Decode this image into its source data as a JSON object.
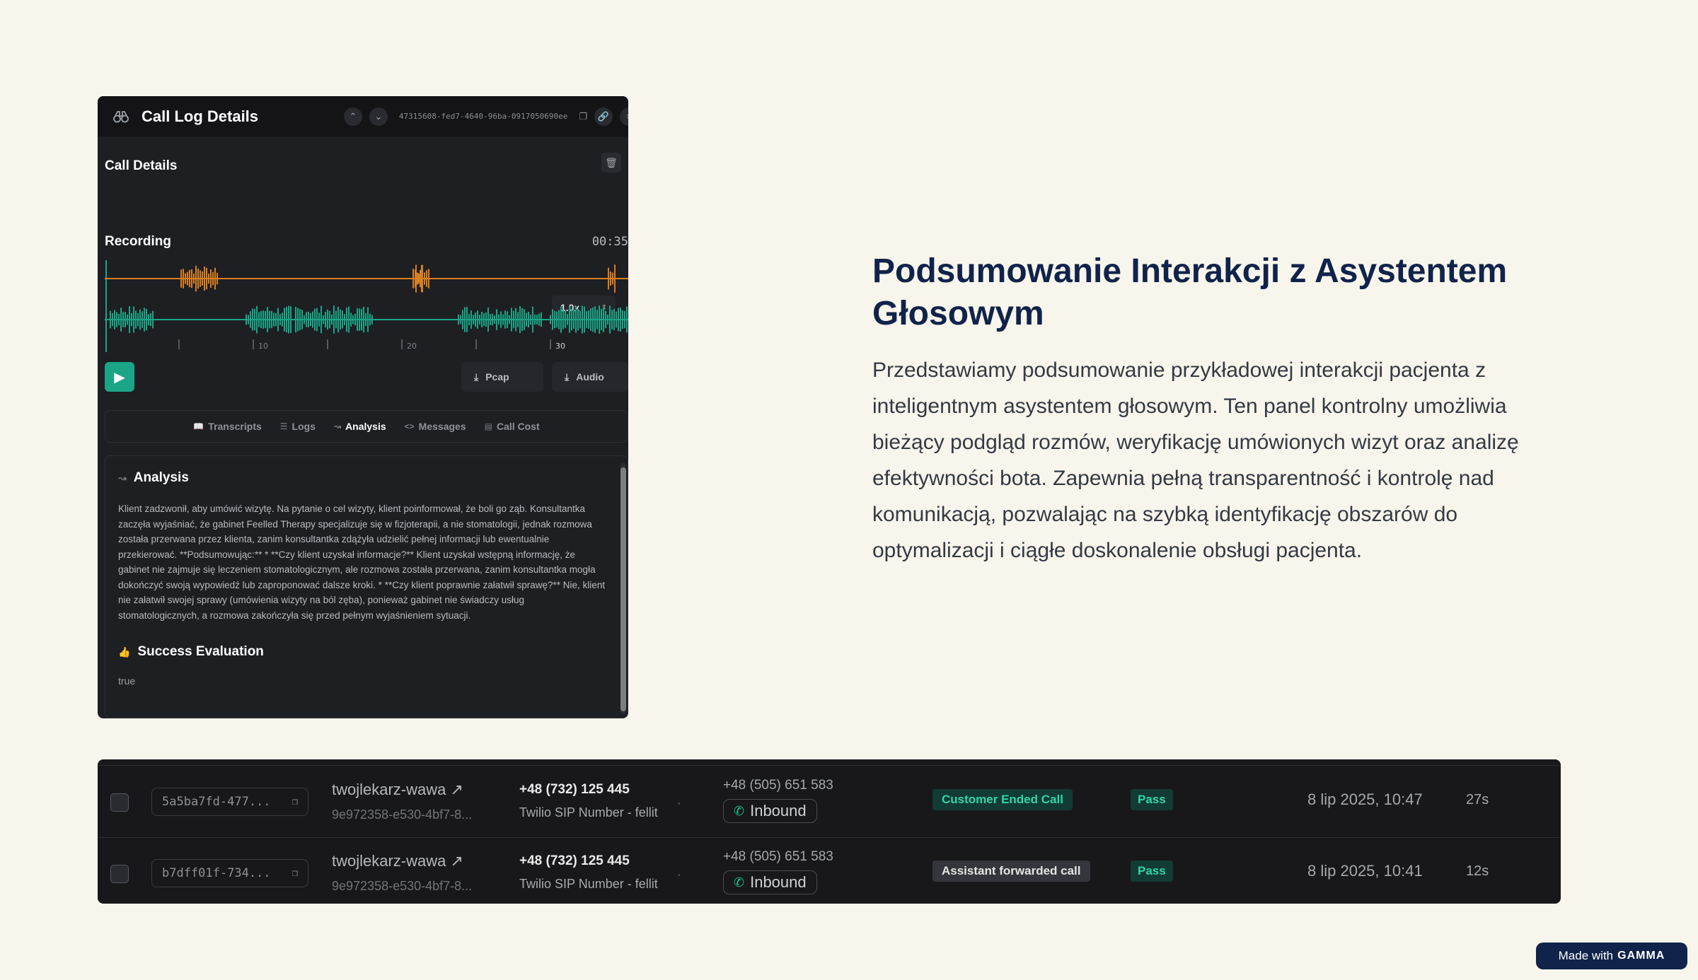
{
  "panel": {
    "header_title": "Call Log Details",
    "call_id": "47315608-fed7-4640-96ba-0917050690ee",
    "call_details_title": "Call Details",
    "speed": "1.0x",
    "recording_title": "Recording",
    "recording_time": "00:35",
    "timeline_ticks": [
      "10",
      "20",
      "30"
    ],
    "pcap_label": "Pcap",
    "audio_label": "Audio",
    "tabs": [
      {
        "label": "Transcripts",
        "icon": "book-icon"
      },
      {
        "label": "Logs",
        "icon": "list-icon"
      },
      {
        "label": "Analysis",
        "icon": "chart-icon",
        "active": true
      },
      {
        "label": "Messages",
        "icon": "code-icon"
      },
      {
        "label": "Call Cost",
        "icon": "bar-chart-icon"
      }
    ],
    "analysis_title": "Analysis",
    "analysis_text": "Klient zadzwonił, aby umówić wizytę. Na pytanie o cel wizyty, klient poinformował, że boli go ząb. Konsultantka zaczęła wyjaśniać, że gabinet Feelled Therapy specjalizuje się w fizjoterapii, a nie stomatologii, jednak rozmowa została przerwana przez klienta, zanim konsultantka zdążyła udzielić pełnej informacji lub ewentualnie przekierować. **Podsumowując:** * **Czy klient uzyskał informacje?** Klient uzyskał wstępną informację, że gabinet nie zajmuje się leczeniem stomatologicznym, ale rozmowa została przerwana, zanim konsultantka mogła dokończyć swoją wypowiedź lub zaproponować dalsze kroki. * **Czy klient poprawnie załatwił sprawę?** Nie, klient nie załatwił swojej sprawy (umówienia wizyty na ból zęba), ponieważ gabinet nie świadczy usług stomatologicznych, a rozmowa zakończyła się przed pełnym wyjaśnieniem sytuacji.",
    "success_title": "Success Evaluation",
    "success_value": "true"
  },
  "heading": "Podsumowanie Interakcji z Asystentem Głosowym",
  "description": "Przedstawiamy podsumowanie przykładowej interakcji pacjenta z inteligentnym asystentem głosowym. Ten panel kontrolny umożliwia bieżący podgląd rozmów, weryfikację umówionych wizyt oraz analizę efektywności bota. Zapewnia pełną transparentność i kontrolę nad komunikacją, pozwalając na szybką identyfikację obszarów do optymalizacji i ciągłe doskonalenie obsługi pacjenta.",
  "table": {
    "rows": [
      {
        "id": "5a5ba7fd-477...",
        "org": "twojlekarz-wawa",
        "org_sub": "9e972358-e530-4bf7-8...",
        "phone": "+48 (732) 125 445",
        "phone_sub": "Twilio SIP Number - fellit",
        "to_phone": "+48 (505) 651 583",
        "direction": "Inbound",
        "reason": "Customer Ended Call",
        "status": "Pass",
        "date": "8 lip 2025, 10:47",
        "duration": "27s"
      },
      {
        "id": "b7dff01f-734...",
        "org": "twojlekarz-wawa",
        "org_sub": "9e972358-e530-4bf7-8...",
        "phone": "+48 (732) 125 445",
        "phone_sub": "Twilio SIP Number - fellit",
        "to_phone": "+48 (505) 651 583",
        "direction": "Inbound",
        "reason": "Assistant forwarded call",
        "status": "Pass",
        "date": "8 lip 2025, 10:41",
        "duration": "12s"
      }
    ]
  },
  "badge": {
    "prefix": "Made with",
    "brand": "GAMMA"
  },
  "colors": {
    "background": "#f8f5ec",
    "heading": "#10234a",
    "accent_green": "#1aa587",
    "wave_orange": "#d77f21",
    "wave_teal": "#1aa587"
  }
}
